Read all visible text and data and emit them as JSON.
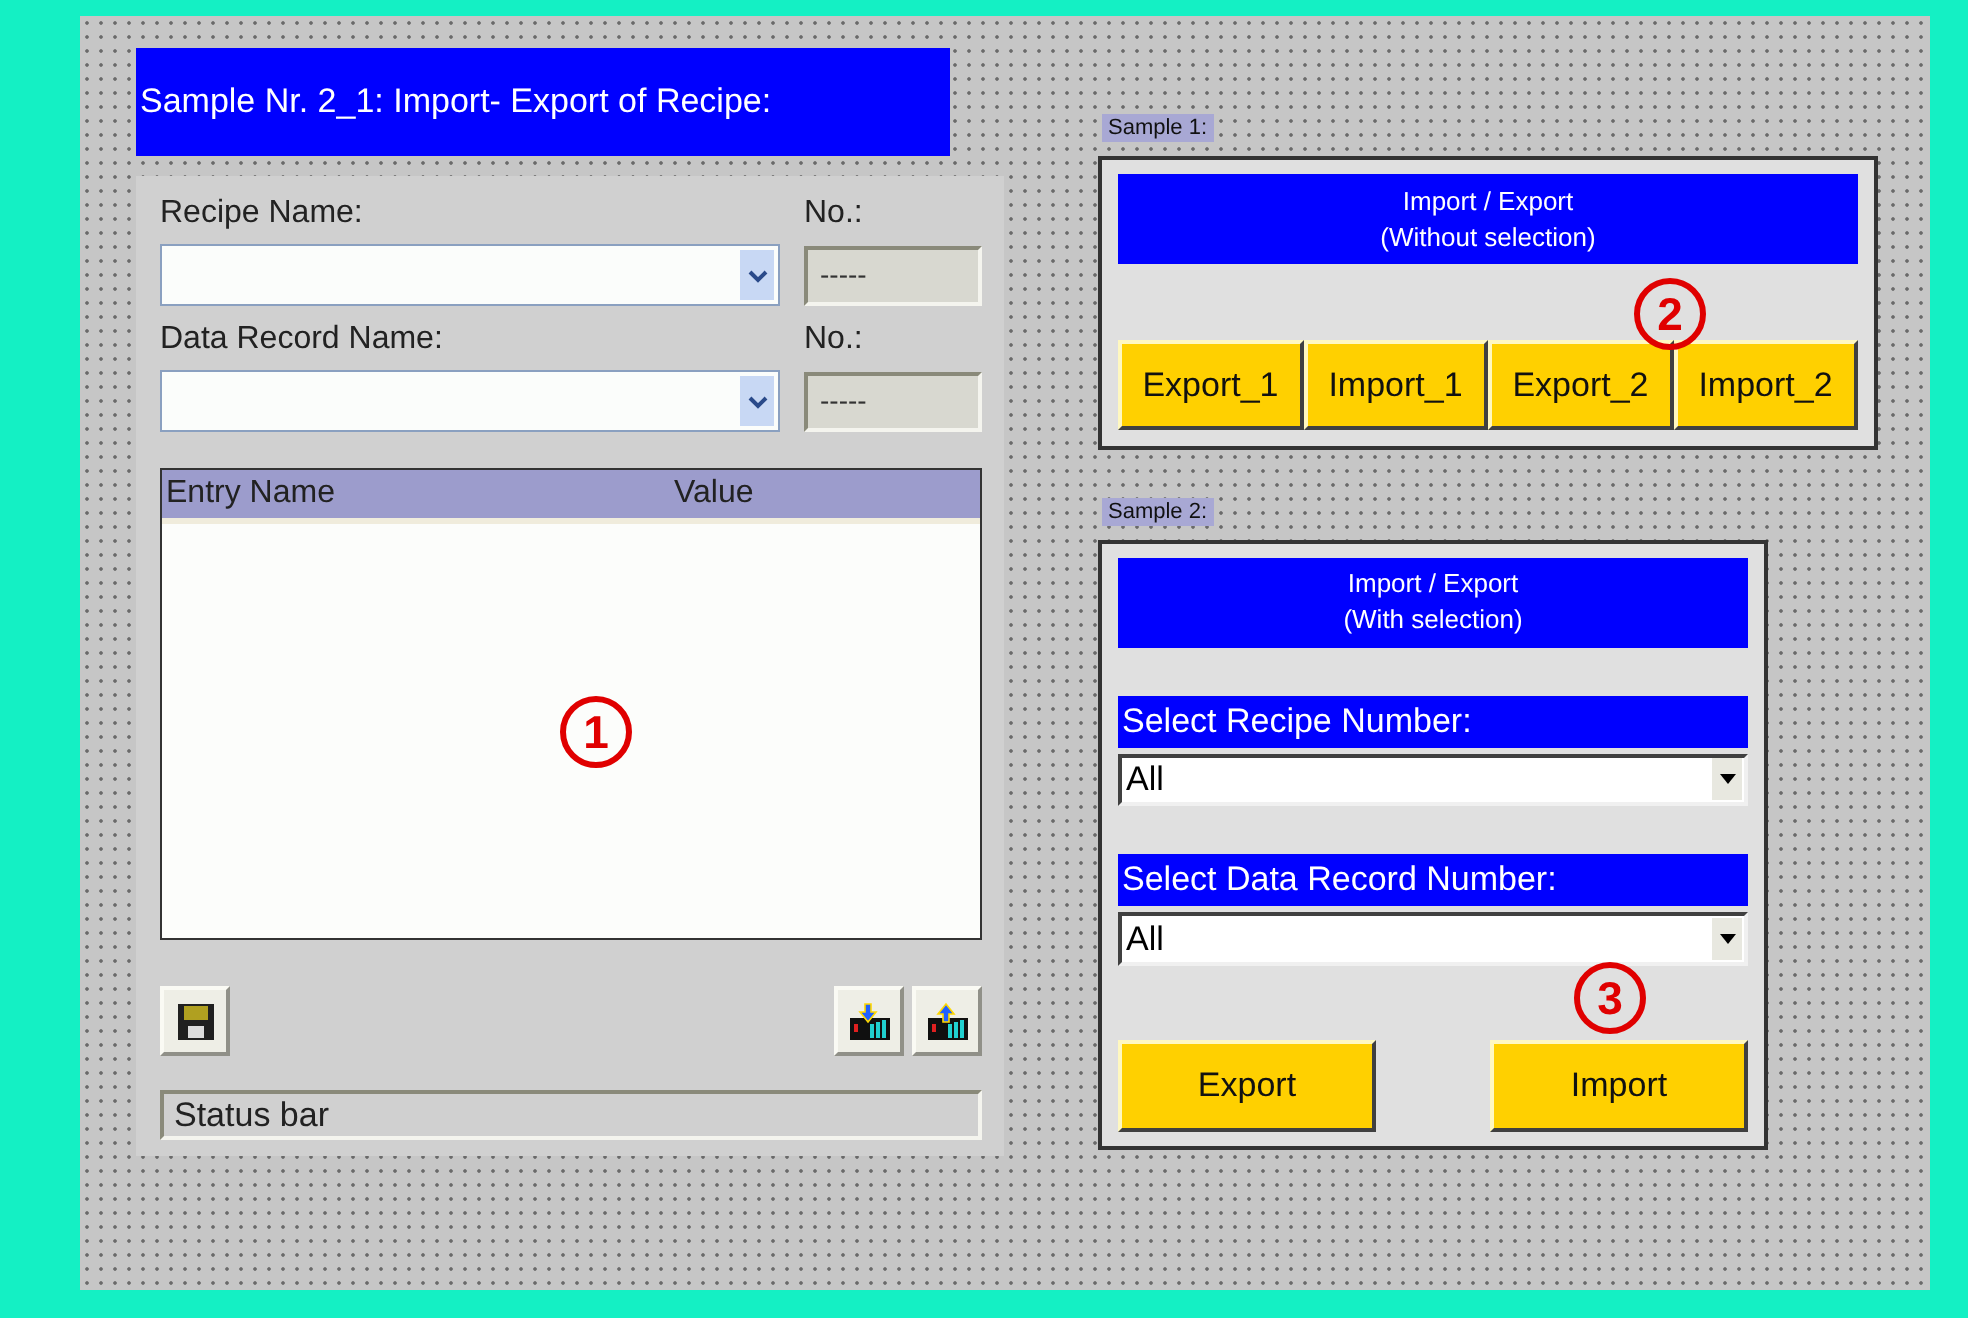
{
  "title": "Sample Nr. 2_1: Import- Export of Recipe:",
  "recipe_panel": {
    "fields": [
      {
        "label": "Recipe Name:",
        "no_label": "No.:",
        "no_value": "-----"
      },
      {
        "label": "Data Record Name:",
        "no_label": "No.:",
        "no_value": "-----"
      }
    ],
    "table": {
      "columns": [
        "Entry Name",
        "Value"
      ]
    },
    "tool_buttons": [
      {
        "kind": "save"
      },
      {
        "kind": "download"
      },
      {
        "kind": "upload"
      }
    ],
    "status_bar": "Status bar"
  },
  "sample_1": {
    "label": "Sample 1:",
    "header": [
      "Import / Export",
      "(Without selection)"
    ],
    "buttons": [
      "Export_1",
      "Import_1",
      "Export_2",
      "Import_2"
    ]
  },
  "sample_2": {
    "label": "Sample 2:",
    "header": [
      "Import / Export",
      "(With selection)"
    ],
    "selects": [
      {
        "label": "Select Recipe Number:",
        "value": "All"
      },
      {
        "label": "Select Data Record Number:",
        "value": "All"
      }
    ],
    "buttons": [
      "Export",
      "Import"
    ]
  },
  "callouts": [
    "1",
    "2",
    "3"
  ]
}
